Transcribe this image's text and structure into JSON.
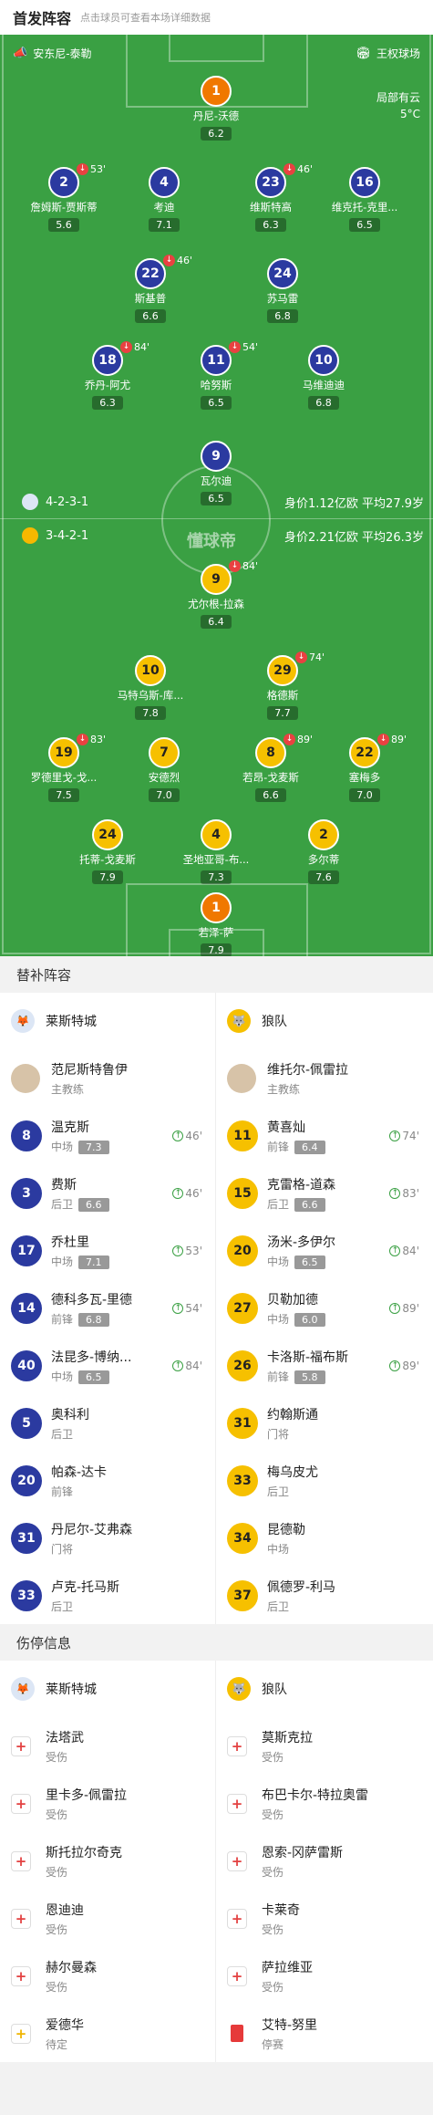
{
  "header": {
    "title": "首发阵容",
    "subtitle": "点击球员可查看本场详细数据"
  },
  "pitch": {
    "home_team": "安东尼-泰勒",
    "venue": "王权球场",
    "weather_text": "局部有云",
    "temperature": "5°C",
    "watermark": "懂球帝",
    "home_formation": "4-2-3-1",
    "home_value": "身价1.12亿欧  平均27.9岁",
    "away_formation": "3-4-2-1",
    "away_value": "身价2.21亿欧  平均26.3岁",
    "home_players": [
      {
        "num": "1",
        "name": "丹尼-沃德",
        "rating": "6.2",
        "color": "orange"
      },
      {
        "num": "2",
        "name": "詹姆斯-贾斯蒂",
        "rating": "5.6",
        "sub": "53'",
        "color": "blue"
      },
      {
        "num": "4",
        "name": "考迪",
        "rating": "7.1",
        "color": "blue"
      },
      {
        "num": "23",
        "name": "维斯特高",
        "rating": "6.3",
        "sub": "46'",
        "color": "blue"
      },
      {
        "num": "16",
        "name": "维克托-克里...",
        "rating": "6.5",
        "color": "blue"
      },
      {
        "num": "22",
        "name": "斯基普",
        "rating": "6.6",
        "sub": "46'",
        "color": "blue"
      },
      {
        "num": "24",
        "name": "苏马雷",
        "rating": "6.8",
        "color": "blue"
      },
      {
        "num": "18",
        "name": "乔丹-阿尤",
        "rating": "6.3",
        "sub": "84'",
        "color": "blue"
      },
      {
        "num": "11",
        "name": "哈努斯",
        "rating": "6.5",
        "sub": "54'",
        "color": "blue"
      },
      {
        "num": "10",
        "name": "马维迪迪",
        "rating": "6.8",
        "color": "blue"
      },
      {
        "num": "9",
        "name": "瓦尔迪",
        "rating": "6.5",
        "color": "blue"
      }
    ],
    "away_players": [
      {
        "num": "9",
        "name": "尤尔根-拉森",
        "rating": "6.4",
        "sub": "84'",
        "color": "yellow"
      },
      {
        "num": "10",
        "name": "马特乌斯-库...",
        "rating": "7.8",
        "color": "yellow"
      },
      {
        "num": "29",
        "name": "格德斯",
        "rating": "7.7",
        "sub": "74'",
        "color": "yellow"
      },
      {
        "num": "19",
        "name": "罗德里戈-戈...",
        "rating": "7.5",
        "sub": "83'",
        "color": "yellow"
      },
      {
        "num": "7",
        "name": "安德烈",
        "rating": "7.0",
        "color": "yellow"
      },
      {
        "num": "8",
        "name": "若昂-戈麦斯",
        "rating": "6.6",
        "sub": "89'",
        "color": "yellow"
      },
      {
        "num": "22",
        "name": "塞梅多",
        "rating": "7.0",
        "sub": "89'",
        "color": "yellow"
      },
      {
        "num": "24",
        "name": "托蒂-戈麦斯",
        "rating": "7.9",
        "color": "yellow"
      },
      {
        "num": "4",
        "name": "圣地亚哥-布...",
        "rating": "7.3",
        "color": "yellow"
      },
      {
        "num": "2",
        "name": "多尔蒂",
        "rating": "7.6",
        "color": "yellow"
      },
      {
        "num": "1",
        "name": "若泽-萨",
        "rating": "7.9",
        "color": "orange"
      }
    ]
  },
  "subs": {
    "title": "替补阵容",
    "home_team": "莱斯特城",
    "away_team": "狼队",
    "home_coach": {
      "name": "范尼斯特鲁伊",
      "role": "主教练"
    },
    "away_coach": {
      "name": "维托尔-佩雷拉",
      "role": "主教练"
    },
    "home": [
      {
        "num": "8",
        "name": "温克斯",
        "pos": "中场",
        "rating": "7.3",
        "in": "46'"
      },
      {
        "num": "3",
        "name": "费斯",
        "pos": "后卫",
        "rating": "6.6",
        "in": "46'"
      },
      {
        "num": "17",
        "name": "乔杜里",
        "pos": "中场",
        "rating": "7.1",
        "in": "53'"
      },
      {
        "num": "14",
        "name": "德科多瓦-里德",
        "pos": "前锋",
        "rating": "6.8",
        "in": "54'"
      },
      {
        "num": "40",
        "name": "法昆多-博纳...",
        "pos": "中场",
        "rating": "6.5",
        "in": "84'"
      },
      {
        "num": "5",
        "name": "奥科利",
        "pos": "后卫"
      },
      {
        "num": "20",
        "name": "帕森-达卡",
        "pos": "前锋"
      },
      {
        "num": "31",
        "name": "丹尼尔-艾弗森",
        "pos": "门将"
      },
      {
        "num": "33",
        "name": "卢克-托马斯",
        "pos": "后卫"
      }
    ],
    "away": [
      {
        "num": "11",
        "name": "黄喜灿",
        "pos": "前锋",
        "rating": "6.4",
        "in": "74'"
      },
      {
        "num": "15",
        "name": "克雷格-道森",
        "pos": "后卫",
        "rating": "6.6",
        "in": "83'"
      },
      {
        "num": "20",
        "name": "汤米-多伊尔",
        "pos": "中场",
        "rating": "6.5",
        "in": "84'"
      },
      {
        "num": "27",
        "name": "贝勒加德",
        "pos": "中场",
        "rating": "6.0",
        "in": "89'"
      },
      {
        "num": "26",
        "name": "卡洛斯-福布斯",
        "pos": "前锋",
        "rating": "5.8",
        "in": "89'"
      },
      {
        "num": "31",
        "name": "约翰斯通",
        "pos": "门将"
      },
      {
        "num": "33",
        "name": "梅乌皮尤",
        "pos": "后卫"
      },
      {
        "num": "34",
        "name": "昆德勒",
        "pos": "中场"
      },
      {
        "num": "37",
        "name": "佩德罗-利马",
        "pos": "后卫"
      }
    ]
  },
  "injuries": {
    "title": "伤停信息",
    "home_team": "莱斯特城",
    "away_team": "狼队",
    "home": [
      {
        "name": "法塔武",
        "status": "受伤",
        "type": "injury"
      },
      {
        "name": "里卡多-佩雷拉",
        "status": "受伤",
        "type": "injury"
      },
      {
        "name": "斯托拉尔奇克",
        "status": "受伤",
        "type": "injury"
      },
      {
        "name": "恩迪迪",
        "status": "受伤",
        "type": "injury"
      },
      {
        "name": "赫尔曼森",
        "status": "受伤",
        "type": "injury"
      },
      {
        "name": "爱德华",
        "status": "待定",
        "type": "pending"
      }
    ],
    "away": [
      {
        "name": "莫斯克拉",
        "status": "受伤",
        "type": "injury"
      },
      {
        "name": "布巴卡尔-特拉奥雷",
        "status": "受伤",
        "type": "injury"
      },
      {
        "name": "恩索-冈萨雷斯",
        "status": "受伤",
        "type": "injury"
      },
      {
        "name": "卡莱奇",
        "status": "受伤",
        "type": "injury"
      },
      {
        "name": "萨拉维亚",
        "status": "受伤",
        "type": "injury"
      },
      {
        "name": "艾特-努里",
        "status": "停赛",
        "type": "suspended"
      }
    ]
  },
  "colors": {
    "pitch": "#3aa043",
    "home": "#2b3aa0",
    "away": "#f6c000",
    "gk": "#f07800"
  }
}
